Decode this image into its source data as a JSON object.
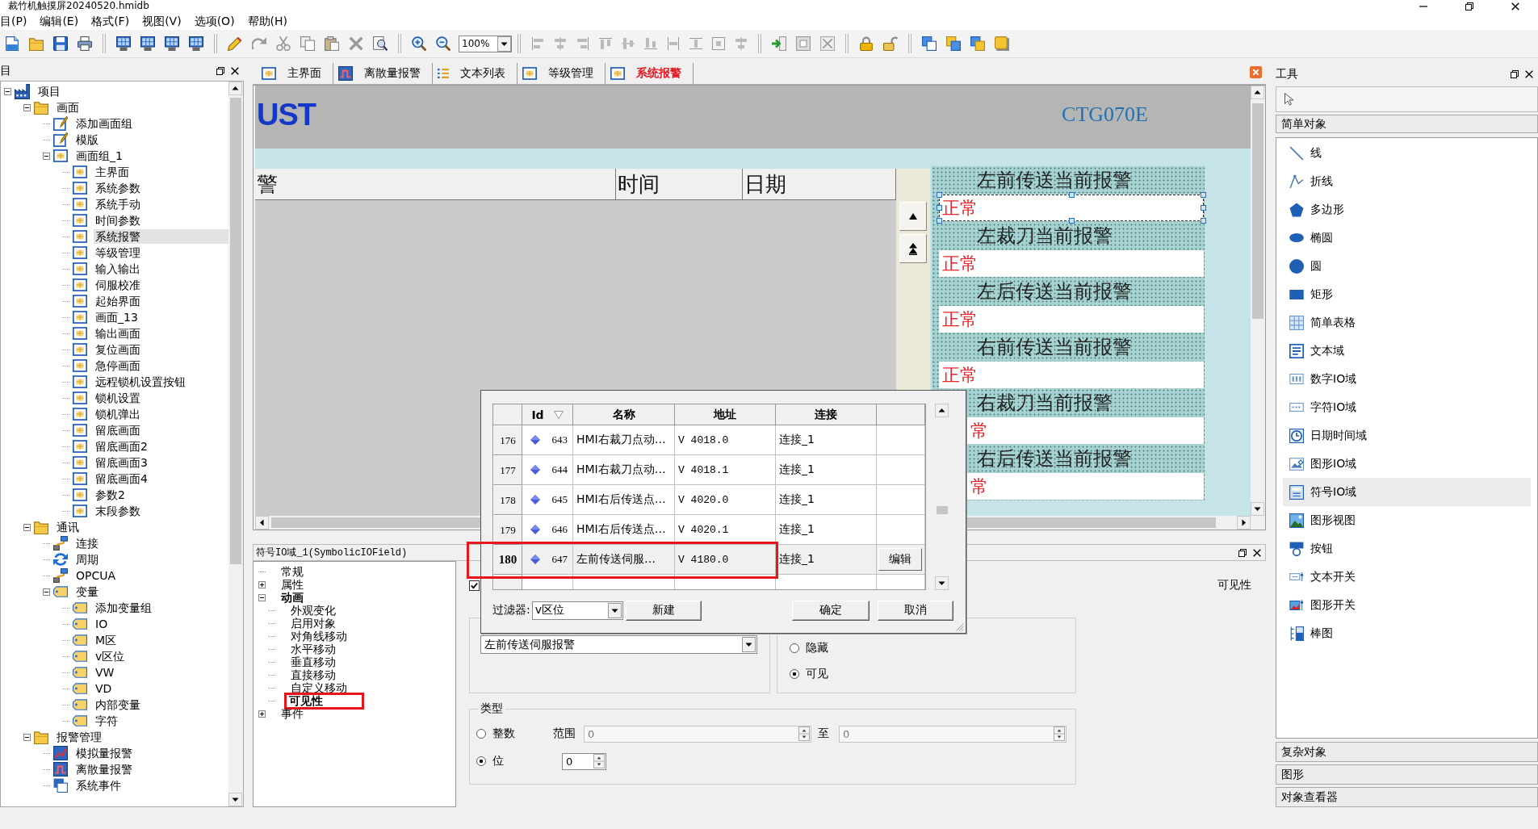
{
  "window": {
    "title": "裁竹机触摸屏20240520.hmidb"
  },
  "menu": [
    "目(P)",
    "编辑(E)",
    "格式(F)",
    "视图(V)",
    "选项(O)",
    "帮助(H)"
  ],
  "toolbar": {
    "zoom": "100%"
  },
  "project_panel": {
    "title": "目",
    "tree": [
      {
        "label": "项目",
        "kind": "project",
        "expanded": true,
        "selected": false,
        "children": [
          {
            "label": "画面",
            "kind": "folder",
            "expanded": true,
            "selected": false,
            "children": [
              {
                "label": "添加画面组",
                "kind": "page",
                "selected": false
              },
              {
                "label": "模版",
                "kind": "page",
                "selected": false
              },
              {
                "label": "画面组_1",
                "kind": "screen",
                "expanded": true,
                "selected": false,
                "children": [
                  {
                    "label": "主界面",
                    "kind": "screen",
                    "selected": false
                  },
                  {
                    "label": "系统参数",
                    "kind": "screen",
                    "selected": false
                  },
                  {
                    "label": "系统手动",
                    "kind": "screen",
                    "selected": false
                  },
                  {
                    "label": "时间参数",
                    "kind": "screen",
                    "selected": false
                  },
                  {
                    "label": "系统报警",
                    "kind": "screen",
                    "selected": true
                  },
                  {
                    "label": "等级管理",
                    "kind": "screen",
                    "selected": false
                  },
                  {
                    "label": "输入输出",
                    "kind": "screen",
                    "selected": false
                  },
                  {
                    "label": "伺服校准",
                    "kind": "screen",
                    "selected": false
                  },
                  {
                    "label": "起始界面",
                    "kind": "screen",
                    "selected": false
                  },
                  {
                    "label": "画面_13",
                    "kind": "screen",
                    "selected": false
                  },
                  {
                    "label": "输出画面",
                    "kind": "screen",
                    "selected": false
                  },
                  {
                    "label": "复位画面",
                    "kind": "screen",
                    "selected": false
                  },
                  {
                    "label": "急停画面",
                    "kind": "screen",
                    "selected": false
                  },
                  {
                    "label": "远程锁机设置按钮",
                    "kind": "screen",
                    "selected": false
                  },
                  {
                    "label": "锁机设置",
                    "kind": "screen",
                    "selected": false
                  },
                  {
                    "label": "锁机弹出",
                    "kind": "screen",
                    "selected": false
                  },
                  {
                    "label": "留底画面",
                    "kind": "screen",
                    "selected": false
                  },
                  {
                    "label": "留底画面2",
                    "kind": "screen",
                    "selected": false
                  },
                  {
                    "label": "留底画面3",
                    "kind": "screen",
                    "selected": false
                  },
                  {
                    "label": "留底画面4",
                    "kind": "screen",
                    "selected": false
                  },
                  {
                    "label": "参数2",
                    "kind": "screen",
                    "selected": false
                  },
                  {
                    "label": "末段参数",
                    "kind": "screen",
                    "selected": false
                  }
                ]
              }
            ]
          },
          {
            "label": "通讯",
            "kind": "folder",
            "expanded": true,
            "selected": false,
            "children": [
              {
                "label": "连接",
                "kind": "connection",
                "selected": false
              },
              {
                "label": "周期",
                "kind": "cycle",
                "selected": false
              },
              {
                "label": "OPCUA",
                "kind": "connection",
                "selected": false
              },
              {
                "label": "变量",
                "kind": "tag",
                "expanded": true,
                "selected": false,
                "children": [
                  {
                    "label": "添加变量组",
                    "kind": "tag",
                    "selected": false
                  },
                  {
                    "label": "IO",
                    "kind": "tag",
                    "selected": false
                  },
                  {
                    "label": "M区",
                    "kind": "tag",
                    "selected": false
                  },
                  {
                    "label": "v区位",
                    "kind": "tag",
                    "selected": false
                  },
                  {
                    "label": "VW",
                    "kind": "tag",
                    "selected": false
                  },
                  {
                    "label": "VD",
                    "kind": "tag",
                    "selected": false
                  },
                  {
                    "label": "内部变量",
                    "kind": "tag",
                    "selected": false
                  },
                  {
                    "label": "字符",
                    "kind": "tag",
                    "selected": false
                  }
                ]
              }
            ]
          },
          {
            "label": "报警管理",
            "kind": "folder",
            "expanded": true,
            "selected": false,
            "children": [
              {
                "label": "模拟量报警",
                "kind": "analog",
                "selected": false
              },
              {
                "label": "离散量报警",
                "kind": "discrete",
                "selected": false
              },
              {
                "label": "系统事件",
                "kind": "event",
                "selected": false
              }
            ]
          }
        ]
      }
    ]
  },
  "tabs": [
    {
      "label": "主界面",
      "kind": "screen",
      "selected": false
    },
    {
      "label": "离散量报警",
      "kind": "alarm",
      "selected": false
    },
    {
      "label": "文本列表",
      "kind": "list",
      "selected": false
    },
    {
      "label": "等级管理",
      "kind": "screen",
      "selected": false
    },
    {
      "label": "系统报警",
      "kind": "screen",
      "selected": true
    }
  ],
  "canvas": {
    "logo": "UST",
    "model": "CTG070E",
    "alarm_table": {
      "columns": [
        "警",
        "时间",
        "日期"
      ]
    },
    "alarm_fields": [
      {
        "label": "左前传送当前报警",
        "value": "正常",
        "selected": true
      },
      {
        "label": "左裁刀当前报警",
        "value": "正常",
        "selected": false
      },
      {
        "label": "左后传送当前报警",
        "value": "正常",
        "selected": false
      },
      {
        "label": "右前传送当前报警",
        "value": "正常",
        "selected": false
      },
      {
        "label": "右裁刀当前报警",
        "value": "常",
        "selected": false
      },
      {
        "label": "右后传送当前报警",
        "value": "常",
        "selected": false
      }
    ]
  },
  "properties": {
    "title": "符号IO域_1(SymbolicIOField)",
    "tree": [
      {
        "label": "常规",
        "selected": false,
        "highlighted": false
      },
      {
        "label": "属性",
        "expanded": false,
        "selected": false,
        "highlighted": false
      },
      {
        "label": "动画",
        "expanded": true,
        "selected": false,
        "highlighted": false,
        "children": [
          {
            "label": "外观变化",
            "selected": false,
            "highlighted": false
          },
          {
            "label": "启用对象",
            "selected": false,
            "highlighted": false
          },
          {
            "label": "对角线移动",
            "selected": false,
            "highlighted": false
          },
          {
            "label": "水平移动",
            "selected": false,
            "highlighted": false
          },
          {
            "label": "垂直移动",
            "selected": false,
            "highlighted": false
          },
          {
            "label": "直接移动",
            "selected": false,
            "highlighted": false
          },
          {
            "label": "自定义移动",
            "selected": false,
            "highlighted": false
          },
          {
            "label": "可见性",
            "selected": true,
            "highlighted": true
          }
        ]
      },
      {
        "label": "事件",
        "expanded": false,
        "selected": false,
        "highlighted": false
      }
    ],
    "checkbox": {
      "checked": true
    },
    "heading": "可见性",
    "variable": "左前传送伺服报警",
    "visibility": [
      {
        "label": "隐藏",
        "selected": false
      },
      {
        "label": "可见",
        "selected": true
      }
    ],
    "type": {
      "label": "类型",
      "options": [
        {
          "label": "整数",
          "selected": false
        },
        {
          "label": "位",
          "selected": true
        }
      ],
      "range_label": "范围",
      "range_from": {
        "value": "0",
        "disabled": true
      },
      "range_to_label": "至",
      "range_to": {
        "value": "0",
        "disabled": true
      },
      "bit": {
        "value": "0",
        "disabled": false
      }
    }
  },
  "dialog": {
    "columns": [
      {
        "label": "Id",
        "sorted": true
      },
      {
        "label": "名称",
        "sorted": false
      },
      {
        "label": "地址",
        "sorted": false
      },
      {
        "label": "连接",
        "sorted": false
      }
    ],
    "rows": [
      {
        "number": "176",
        "id": "643",
        "name": "HMI右裁刀点动…",
        "address": "V 4018.0",
        "connection": "连接_1",
        "selected": false,
        "highlighted": false
      },
      {
        "number": "177",
        "id": "644",
        "name": "HMI右裁刀点动…",
        "address": "V 4018.1",
        "connection": "连接_1",
        "selected": false,
        "highlighted": false
      },
      {
        "number": "178",
        "id": "645",
        "name": "HMI右后传送点…",
        "address": "V 4020.0",
        "connection": "连接_1",
        "selected": false,
        "highlighted": false
      },
      {
        "number": "179",
        "id": "646",
        "name": "HMI右后传送点…",
        "address": "V 4020.1",
        "connection": "连接_1",
        "selected": false,
        "highlighted": false
      },
      {
        "number": "180",
        "id": "647",
        "name": "左前传送伺服…",
        "address": "V 4180.0",
        "connection": "连接_1",
        "selected": true,
        "highlighted": true,
        "action": "编辑"
      }
    ],
    "filter_label": "过滤器:",
    "filter": "v区位",
    "new_button": "新建",
    "buttons": [
      "确定",
      "取消"
    ]
  },
  "toolbox": {
    "title": "工具",
    "section": "简单对象",
    "items": [
      {
        "label": "线",
        "selected": false
      },
      {
        "label": "折线",
        "selected": false
      },
      {
        "label": "多边形",
        "selected": false
      },
      {
        "label": "椭圆",
        "selected": false
      },
      {
        "label": "圆",
        "selected": false
      },
      {
        "label": "矩形",
        "selected": false
      },
      {
        "label": "简单表格",
        "selected": false
      },
      {
        "label": "文本域",
        "selected": false
      },
      {
        "label": "数字IO域",
        "selected": false
      },
      {
        "label": "字符IO域",
        "selected": false
      },
      {
        "label": "日期时间域",
        "selected": false
      },
      {
        "label": "图形IO域",
        "selected": false
      },
      {
        "label": "符号IO域",
        "selected": true
      },
      {
        "label": "图形视图",
        "selected": false
      },
      {
        "label": "按钮",
        "selected": false
      },
      {
        "label": "文本开关",
        "selected": false
      },
      {
        "label": "图形开关",
        "selected": false
      },
      {
        "label": "棒图",
        "selected": false
      }
    ],
    "sections": [
      "复杂对象",
      "图形",
      "对象查看器"
    ]
  }
}
